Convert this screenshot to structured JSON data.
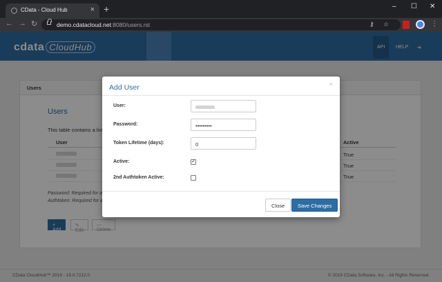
{
  "browser": {
    "tab_title": "CData - Cloud Hub",
    "tab_close": "×",
    "new_tab": "+",
    "url_host": "demo.cdatacloud.net",
    "url_path": ":8080/users.rst",
    "minimize": "–",
    "maximize": "☐",
    "close": "✕"
  },
  "app": {
    "logo_main": "cdata",
    "logo_sub": "CloudHub",
    "nav": [
      "API",
      "HELP"
    ],
    "logout_icon": "➔"
  },
  "panel": {
    "header": "Users",
    "title": "Users",
    "description": "This table contains a list",
    "columns": [
      "User",
      "Active"
    ],
    "rows": [
      {
        "active": "True"
      },
      {
        "active": "True"
      },
      {
        "active": "True"
      }
    ],
    "note1": "Password: Required for access in the UI console (admin only) and through SQL endpoints.",
    "note2": "Authtoken: Required for authentication when accessing the OData service.",
    "buttons": {
      "add": "+ Add",
      "edit": "✎ Edit",
      "delete": "— Delete"
    }
  },
  "footer": {
    "left": "CData CloudHub™ 2019 - 19.0.7212.0",
    "right": "© 2019 CData Software, Inc. - All Rights Reserved."
  },
  "modal": {
    "title": "Add User",
    "close_x": "×",
    "fields": {
      "user_label": "User:",
      "password_label": "Password:",
      "password_value": "•••••••••",
      "token_label": "Token Lifetime (days):",
      "token_value": "0",
      "active_label": "Active:",
      "active_checked": true,
      "authtoken_label": "2nd Authtoken Active:",
      "authtoken_checked": false
    },
    "close_button": "Close",
    "save_button": "Save Changes"
  },
  "colors": {
    "brand": "#2e6da4"
  }
}
